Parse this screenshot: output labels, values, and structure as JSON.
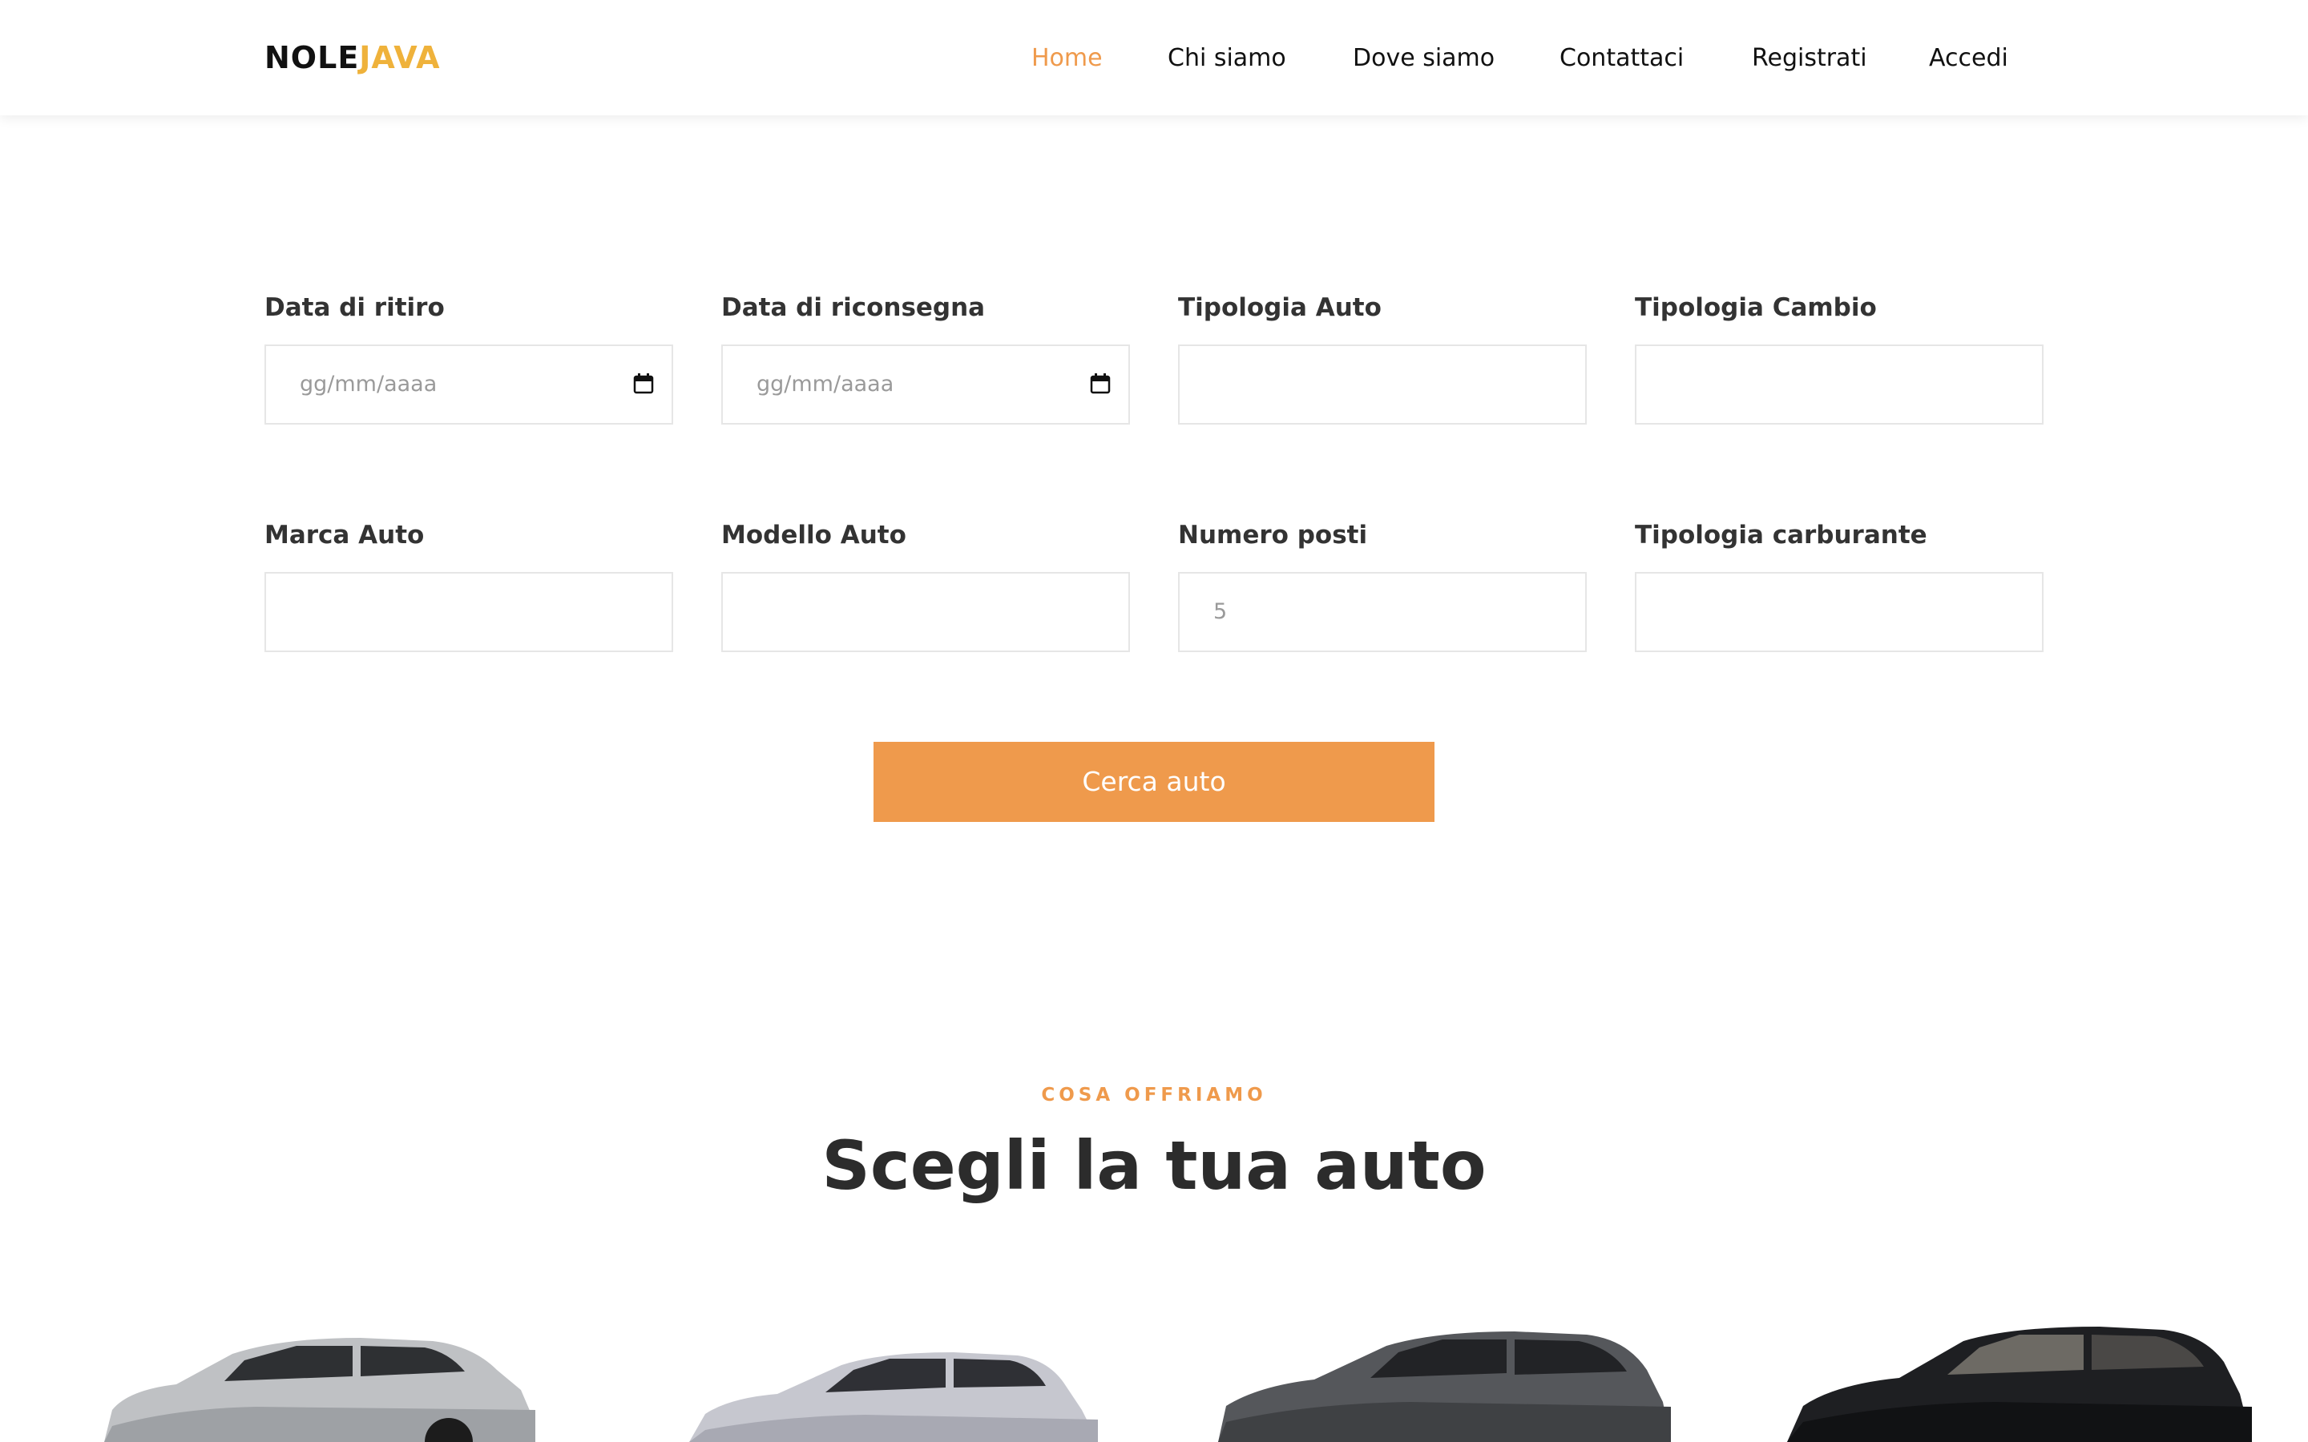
{
  "brand": {
    "part1": "NOLE",
    "part2": "JAVA"
  },
  "nav": {
    "items": [
      {
        "label": "Home"
      },
      {
        "label": "Chi siamo"
      },
      {
        "label": "Dove siamo"
      },
      {
        "label": "Contattaci"
      },
      {
        "label": "Registrati"
      },
      {
        "label": "Accedi"
      }
    ]
  },
  "form": {
    "pickup_date": {
      "label": "Data di ritiro",
      "placeholder": "gg/mm/aaaa"
    },
    "return_date": {
      "label": "Data di riconsegna",
      "placeholder": "gg/mm/aaaa"
    },
    "car_type": {
      "label": "Tipologia Auto",
      "value": ""
    },
    "gearbox_type": {
      "label": "Tipologia Cambio",
      "value": ""
    },
    "car_brand": {
      "label": "Marca Auto",
      "value": ""
    },
    "car_model": {
      "label": "Modello Auto",
      "value": ""
    },
    "seats": {
      "label": "Numero posti",
      "placeholder": "5"
    },
    "fuel_type": {
      "label": "Tipologia carburante",
      "value": ""
    },
    "search_button": "Cerca auto"
  },
  "offer": {
    "kicker": "COSA OFFRIAMO",
    "title": "Scegli la tua auto"
  },
  "colors": {
    "accent": "#ef9a4c",
    "logo_accent": "#efb23b",
    "text_dark": "#2c2c2c"
  }
}
